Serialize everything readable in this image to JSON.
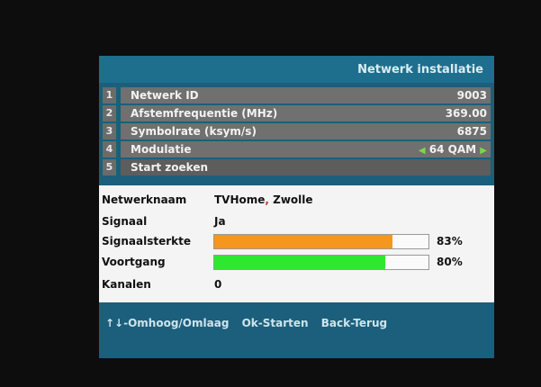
{
  "header": {
    "title": "Netwerk installatie"
  },
  "menu": [
    {
      "num": "1",
      "label": "Netwerk ID",
      "value": "9003"
    },
    {
      "num": "2",
      "label": "Afstemfrequentie (MHz)",
      "value": "369.00"
    },
    {
      "num": "3",
      "label": "Symbolrate (ksym/s)",
      "value": "6875"
    },
    {
      "num": "4",
      "label": "Modulatie",
      "value": "64 QAM"
    },
    {
      "num": "5",
      "label": "Start zoeken",
      "value": ""
    }
  ],
  "info": {
    "netwerknaam_label": "Netwerknaam",
    "netwerknaam_a": "TVHome",
    "netwerknaam_sep": ",",
    "netwerknaam_b": " Zwolle",
    "signaal_label": "Signaal",
    "signaal_value": "Ja",
    "signaalsterkte_label": "Signaalsterkte",
    "signaalsterkte_pct": "83%",
    "signaalsterkte_level": 0.83,
    "voortgang_label": "Voortgang",
    "voortgang_pct": "80%",
    "voortgang_level": 0.8,
    "kanalen_label": "Kanalen",
    "kanalen_value": "0"
  },
  "footer": {
    "nav": "↑↓-Omhoog/Omlaag",
    "ok": "Ok-Starten",
    "back": "Back-Terug"
  },
  "colors": {
    "panel": "#1b5f7c",
    "signal_bar": "#f5961e",
    "progress_bar": "#2ee830",
    "selection_arrows": "#7ad84a"
  }
}
